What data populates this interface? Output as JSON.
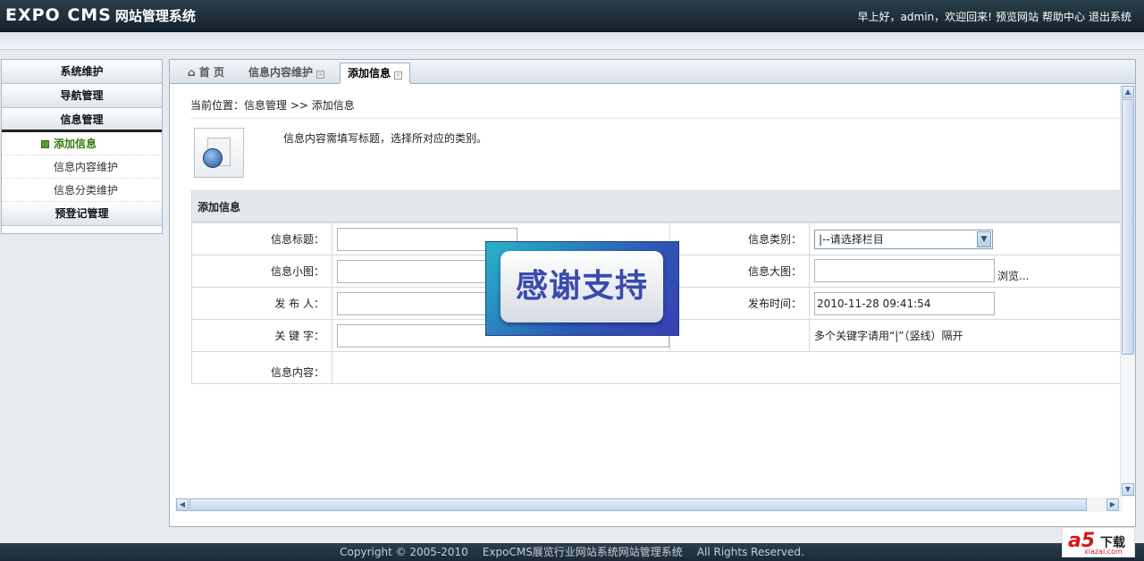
{
  "header": {
    "logo": "EXPO CMS",
    "logo_sub": "网站管理系统",
    "greeting": "早上好，admin，欢迎回来!",
    "links": [
      "预览网站",
      "帮助中心",
      "退出系统"
    ]
  },
  "sidebar": {
    "groups": [
      "系统维护",
      "导航管理",
      "信息管理"
    ],
    "sub_items": [
      "添加信息",
      "信息内容维护",
      "信息分类维护"
    ],
    "last_group": "预登记管理"
  },
  "tabs": [
    {
      "label": "首 页",
      "icon": "home-icon"
    },
    {
      "label": "信息内容维护"
    },
    {
      "label": "添加信息"
    }
  ],
  "page": {
    "breadcrumb": "当前位置：信息管理 >> 添加信息",
    "instruction": "信息内容需填写标题，选择所对应的类别。",
    "section_title": "添加信息"
  },
  "form": {
    "title_label": "信息标题：",
    "category_label": "信息类别：",
    "category_value": "|--请选择栏目",
    "small_image_label": "信息小图：",
    "large_image_label": "信息大图：",
    "browse_label": "浏览...",
    "publisher_label": "发 布 人：",
    "publish_time_label": "发布时间：",
    "publish_time_value": "2010-11-28 09:41:54",
    "keywords_label": "关 键 字：",
    "keywords_hint": "多个关键字请用“|”（竖线）隔开",
    "content_label": "信息内容："
  },
  "overlay": {
    "text": "感谢支持",
    "color_start": "#27b4c9",
    "color_end": "#3a3fb3"
  },
  "footer": {
    "copyright": "Copyright © 2005-2010",
    "system_name": "ExpoCMS展览行业网站系统网站管理系统",
    "rights": "All Rights Reserved."
  },
  "corner_logo": {
    "brand": "a5",
    "text": "下载",
    "site": "xiazai.com"
  }
}
